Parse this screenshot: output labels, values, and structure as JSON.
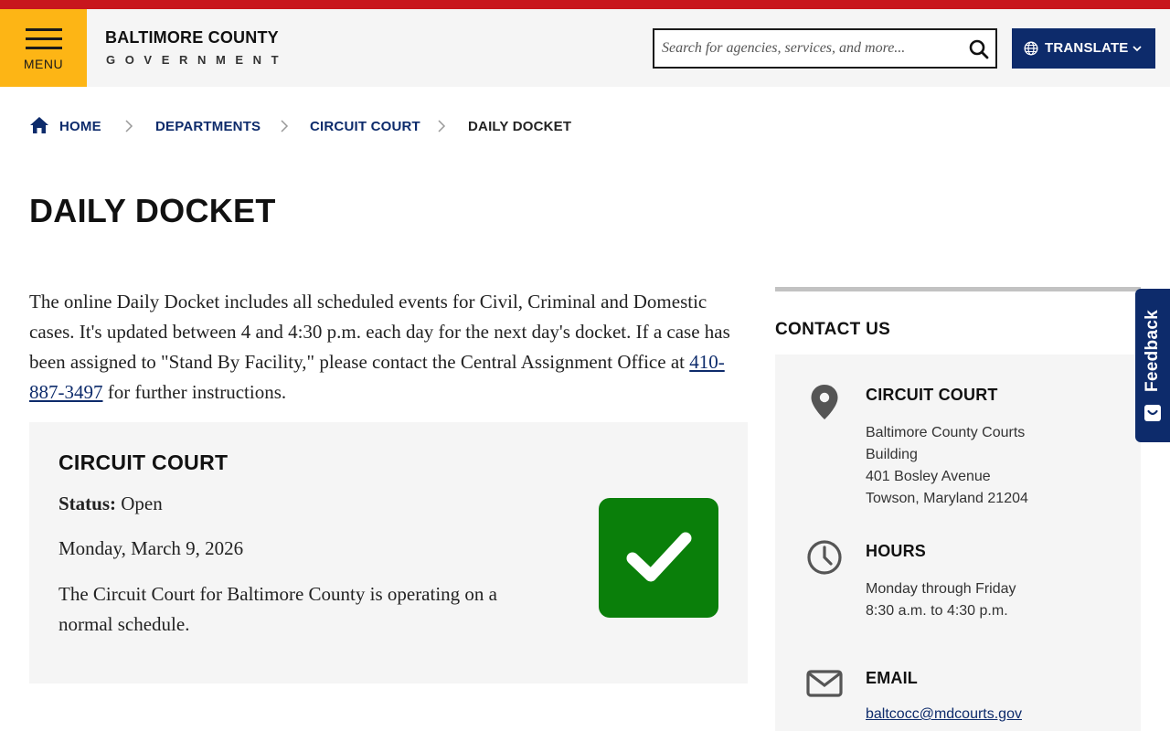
{
  "colors": {
    "accent_red": "#c8161d",
    "menu_yellow": "#fdb515",
    "navy": "#0d2b6b",
    "status_green": "#0a7f0a"
  },
  "header": {
    "menu_label": "MENU",
    "logo_line1": "BALTIMORE COUNTY",
    "logo_line2": "GOVERNMENT",
    "search_placeholder": "Search for agencies, services, and more...",
    "translate_label": "TRANSLATE"
  },
  "breadcrumb": {
    "home": "HOME",
    "departments": "DEPARTMENTS",
    "circuit_court": "CIRCUIT COURT",
    "current": "DAILY DOCKET"
  },
  "page": {
    "title": "DAILY DOCKET",
    "intro_text": "The online Daily Docket includes all scheduled events for Civil, Criminal and Domestic cases. It's updated between 4 and 4:30 p.m. each day for the next day's docket. If a case has been assigned to \"Stand By Facility,\" please contact the Central Assignment Office at ",
    "intro_phone": "410-887-3497",
    "intro_tail": " for further instructions."
  },
  "court_card": {
    "title": "CIRCUIT COURT",
    "status_label": "Status:",
    "status_value": "Open",
    "date": "Monday, March 9, 2026",
    "description": "The Circuit Court for Baltimore County is operating on a normal schedule.",
    "status_icon": "checkmark-icon"
  },
  "contact": {
    "heading": "CONTACT US",
    "location_title": "CIRCUIT COURT",
    "address_line1": "Baltimore County Courts",
    "address_line2": "Building",
    "address_line3": "401 Bosley Avenue",
    "address_line4": "Towson, Maryland 21204",
    "hours_title": "HOURS",
    "hours_line1": "Monday through Friday",
    "hours_line2": "8:30 a.m. to 4:30 p.m.",
    "email_title": "EMAIL",
    "email": "baltcocc@mdcourts.gov"
  },
  "feedback": {
    "label": "Feedback"
  }
}
